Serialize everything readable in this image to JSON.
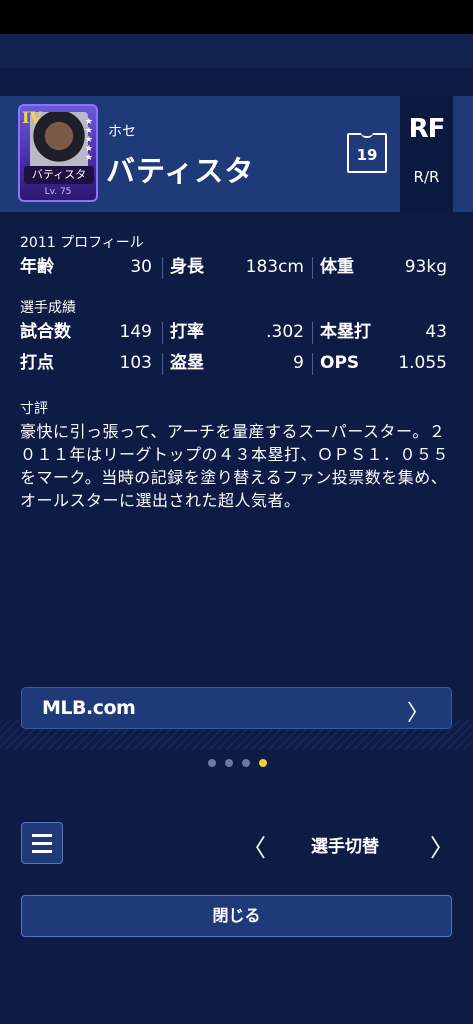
{
  "player": {
    "card_rank": "IV",
    "card_name": "バティスタ",
    "card_level": "Lv. 75",
    "first_name": "ホセ",
    "last_name": "バティスタ",
    "number": "19",
    "position": "RF",
    "bats_throws": "R/R"
  },
  "profile": {
    "label": "2011 プロフィール",
    "age_label": "年齢",
    "age": "30",
    "height_label": "身長",
    "height": "183cm",
    "weight_label": "体重",
    "weight": "93kg"
  },
  "stats": {
    "label": "選手成績",
    "games_label": "試合数",
    "games": "149",
    "avg_label": "打率",
    "avg": ".302",
    "hr_label": "本塁打",
    "hr": "43",
    "rbi_label": "打点",
    "rbi": "103",
    "sb_label": "盗塁",
    "sb": "9",
    "ops_label": "OPS",
    "ops": "1.055"
  },
  "review": {
    "label": "寸評",
    "text": "豪快に引っ張って、アーチを量産するスーパースター。２０１１年はリーグトップの４３本塁打、ＯＰＳ１．０５５をマーク。当時の記録を塗り替えるファン投票数を集め、オールスターに選出された超人気者。"
  },
  "links": {
    "mlb_label": "MLB.com"
  },
  "pager": {
    "count": 4,
    "active_index": 3
  },
  "nav": {
    "switch_label": "選手切替",
    "prev_icon": "chevron-left-icon",
    "next_icon": "chevron-right-icon"
  },
  "footer": {
    "close_label": "閉じる"
  },
  "colors": {
    "background": "#0d1b45",
    "header": "#1f3a78",
    "active_dot": "#f0d232"
  }
}
